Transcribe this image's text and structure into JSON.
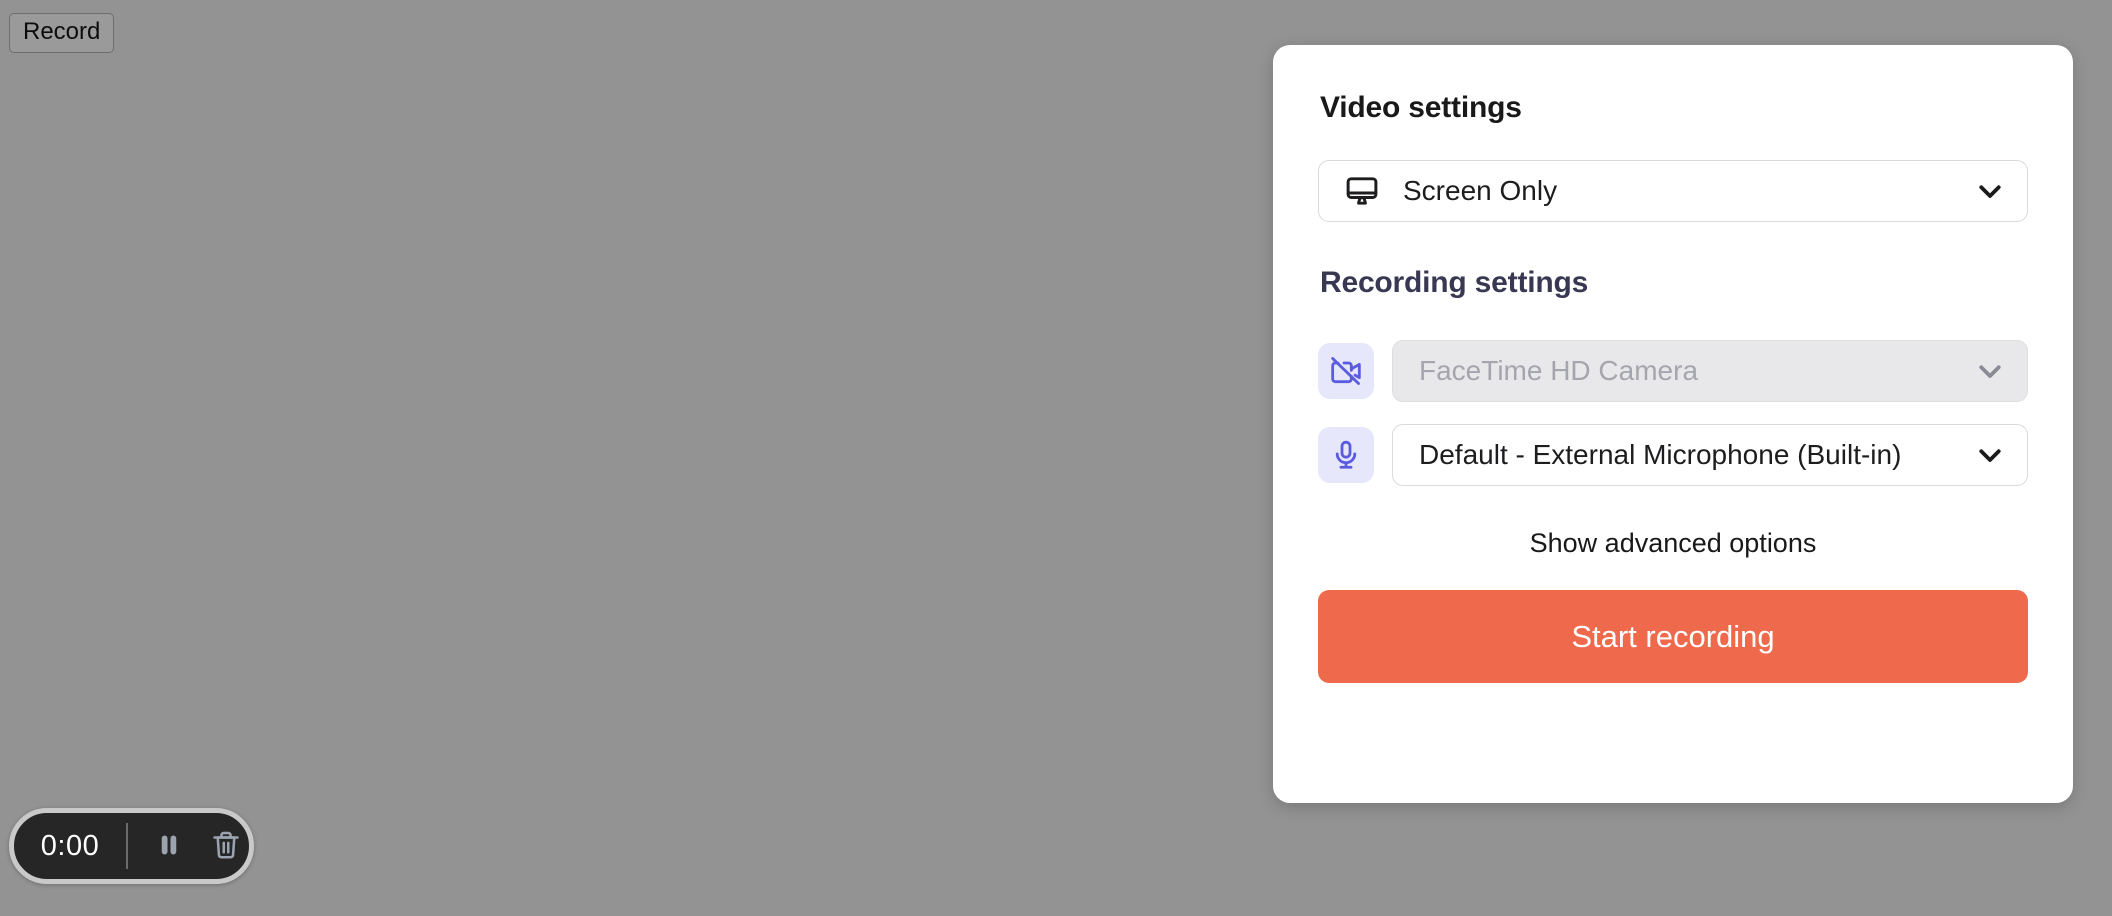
{
  "page": {
    "background_color": "#939393"
  },
  "record_button": {
    "label": "Record"
  },
  "panel": {
    "video_settings": {
      "heading": "Video settings",
      "source_select": {
        "icon": "monitor-icon",
        "value": "Screen Only",
        "chevron": "chevron-down-icon"
      }
    },
    "recording_settings": {
      "heading": "Recording settings",
      "camera": {
        "tile_icon": "video-off-icon",
        "value": "FaceTime HD Camera",
        "disabled": true,
        "chevron": "chevron-down-icon"
      },
      "microphone": {
        "tile_icon": "microphone-icon",
        "value": "Default - External Microphone (Built-in)",
        "disabled": false,
        "chevron": "chevron-down-icon"
      },
      "advanced_options_label": "Show advanced options",
      "start_button_label": "Start recording"
    },
    "colors": {
      "accent_orange": "#ef6a4c",
      "icon_indigo": "#5b5be0",
      "icon_tile_bg": "#e7e7fb",
      "heading_navy": "#383852",
      "disabled_bg": "#e8e8ea"
    }
  },
  "recorder_widget": {
    "timer": "0:00",
    "pause_icon": "pause-icon",
    "delete_icon": "trash-icon",
    "pill_color": "#262626",
    "control_icon_color": "#9ca3b0"
  }
}
